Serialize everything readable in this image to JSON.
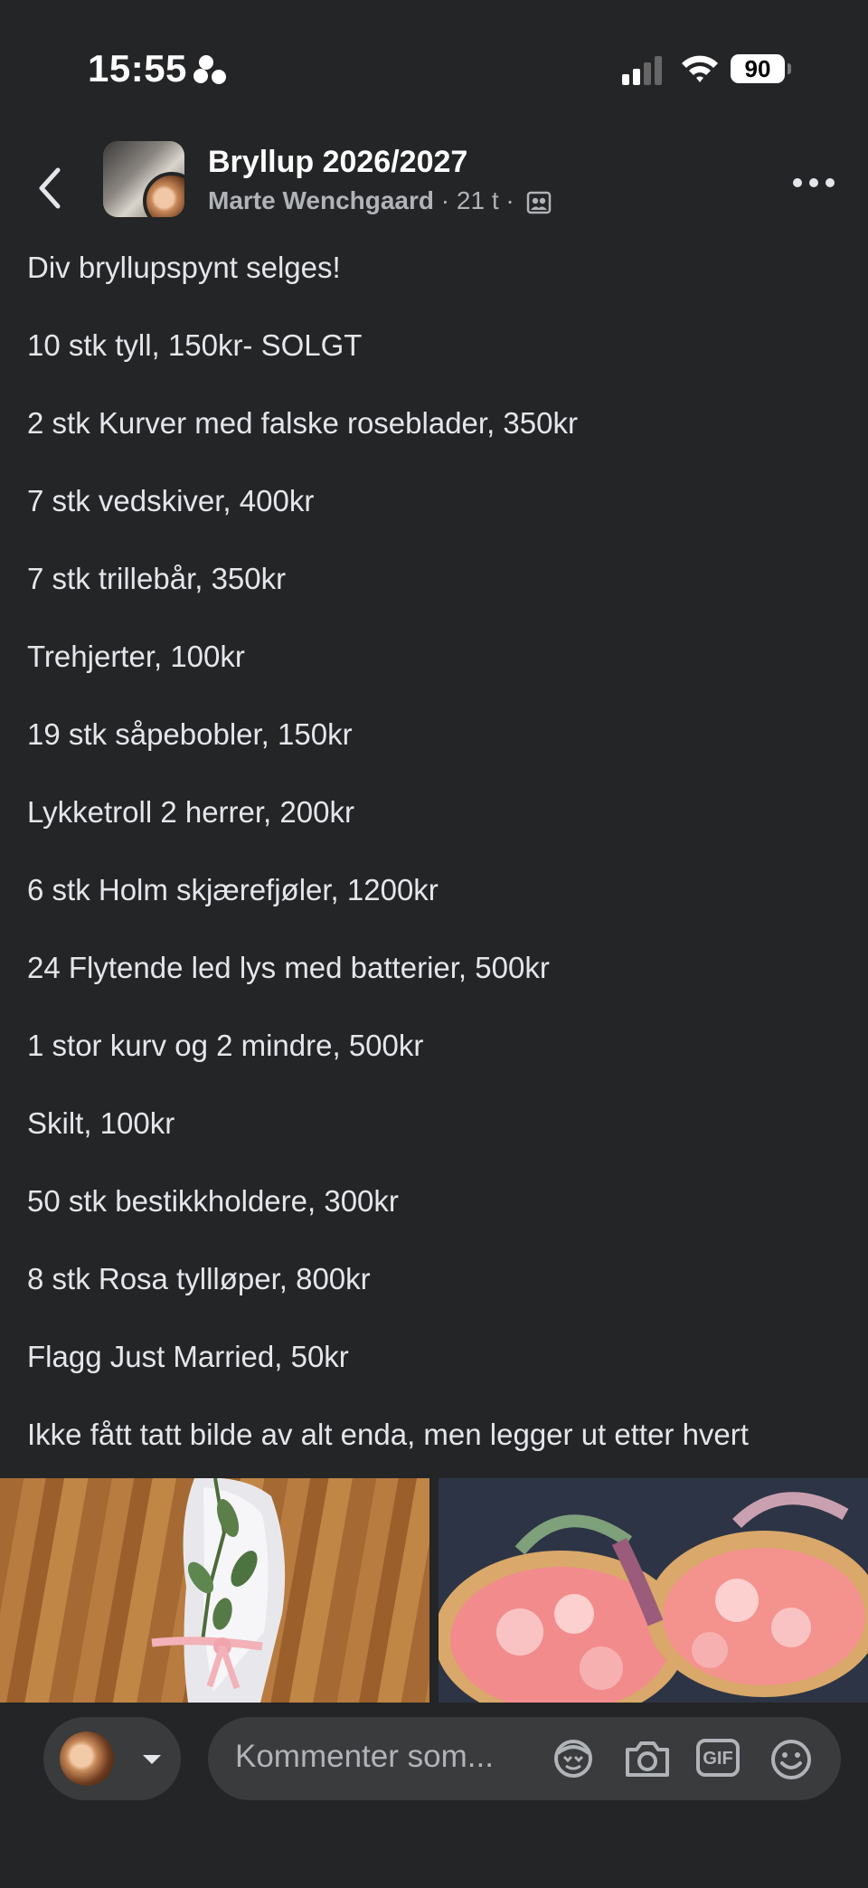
{
  "status_bar": {
    "time": "15:55",
    "battery": "90"
  },
  "header": {
    "title": "Bryllup 2026/2027",
    "author": "Marte Wenchgaard",
    "time_ago": "21 t",
    "separator": "·"
  },
  "post": {
    "lines": [
      "Div bryllupspynt selges!",
      "10 stk tyll, 150kr- SOLGT",
      "2 stk Kurver med falske roseblader, 350kr",
      "7 stk vedskiver, 400kr",
      "7 stk trillebår, 350kr",
      "Trehjerter, 100kr",
      "19 stk såpebobler, 150kr",
      "Lykketroll 2 herrer, 200kr",
      "6 stk Holm skjærefjøler, 1200kr",
      "24 Flytende led lys med batterier, 500kr",
      "1 stor kurv og 2 mindre, 500kr",
      "Skilt, 100kr",
      "50 stk bestikkholdere, 300kr",
      "8 stk Rosa tyllløper, 800kr",
      "Flagg Just Married, 50kr",
      "Ikke fått tatt bilde av alt enda, men legger ut etter hvert"
    ]
  },
  "comment": {
    "placeholder": "Kommenter som...",
    "gif_label": "GIF"
  },
  "colors": {
    "background": "#242526",
    "surface": "#3a3b3c",
    "text": "#e4e6eb",
    "muted": "#b0b3b8"
  }
}
